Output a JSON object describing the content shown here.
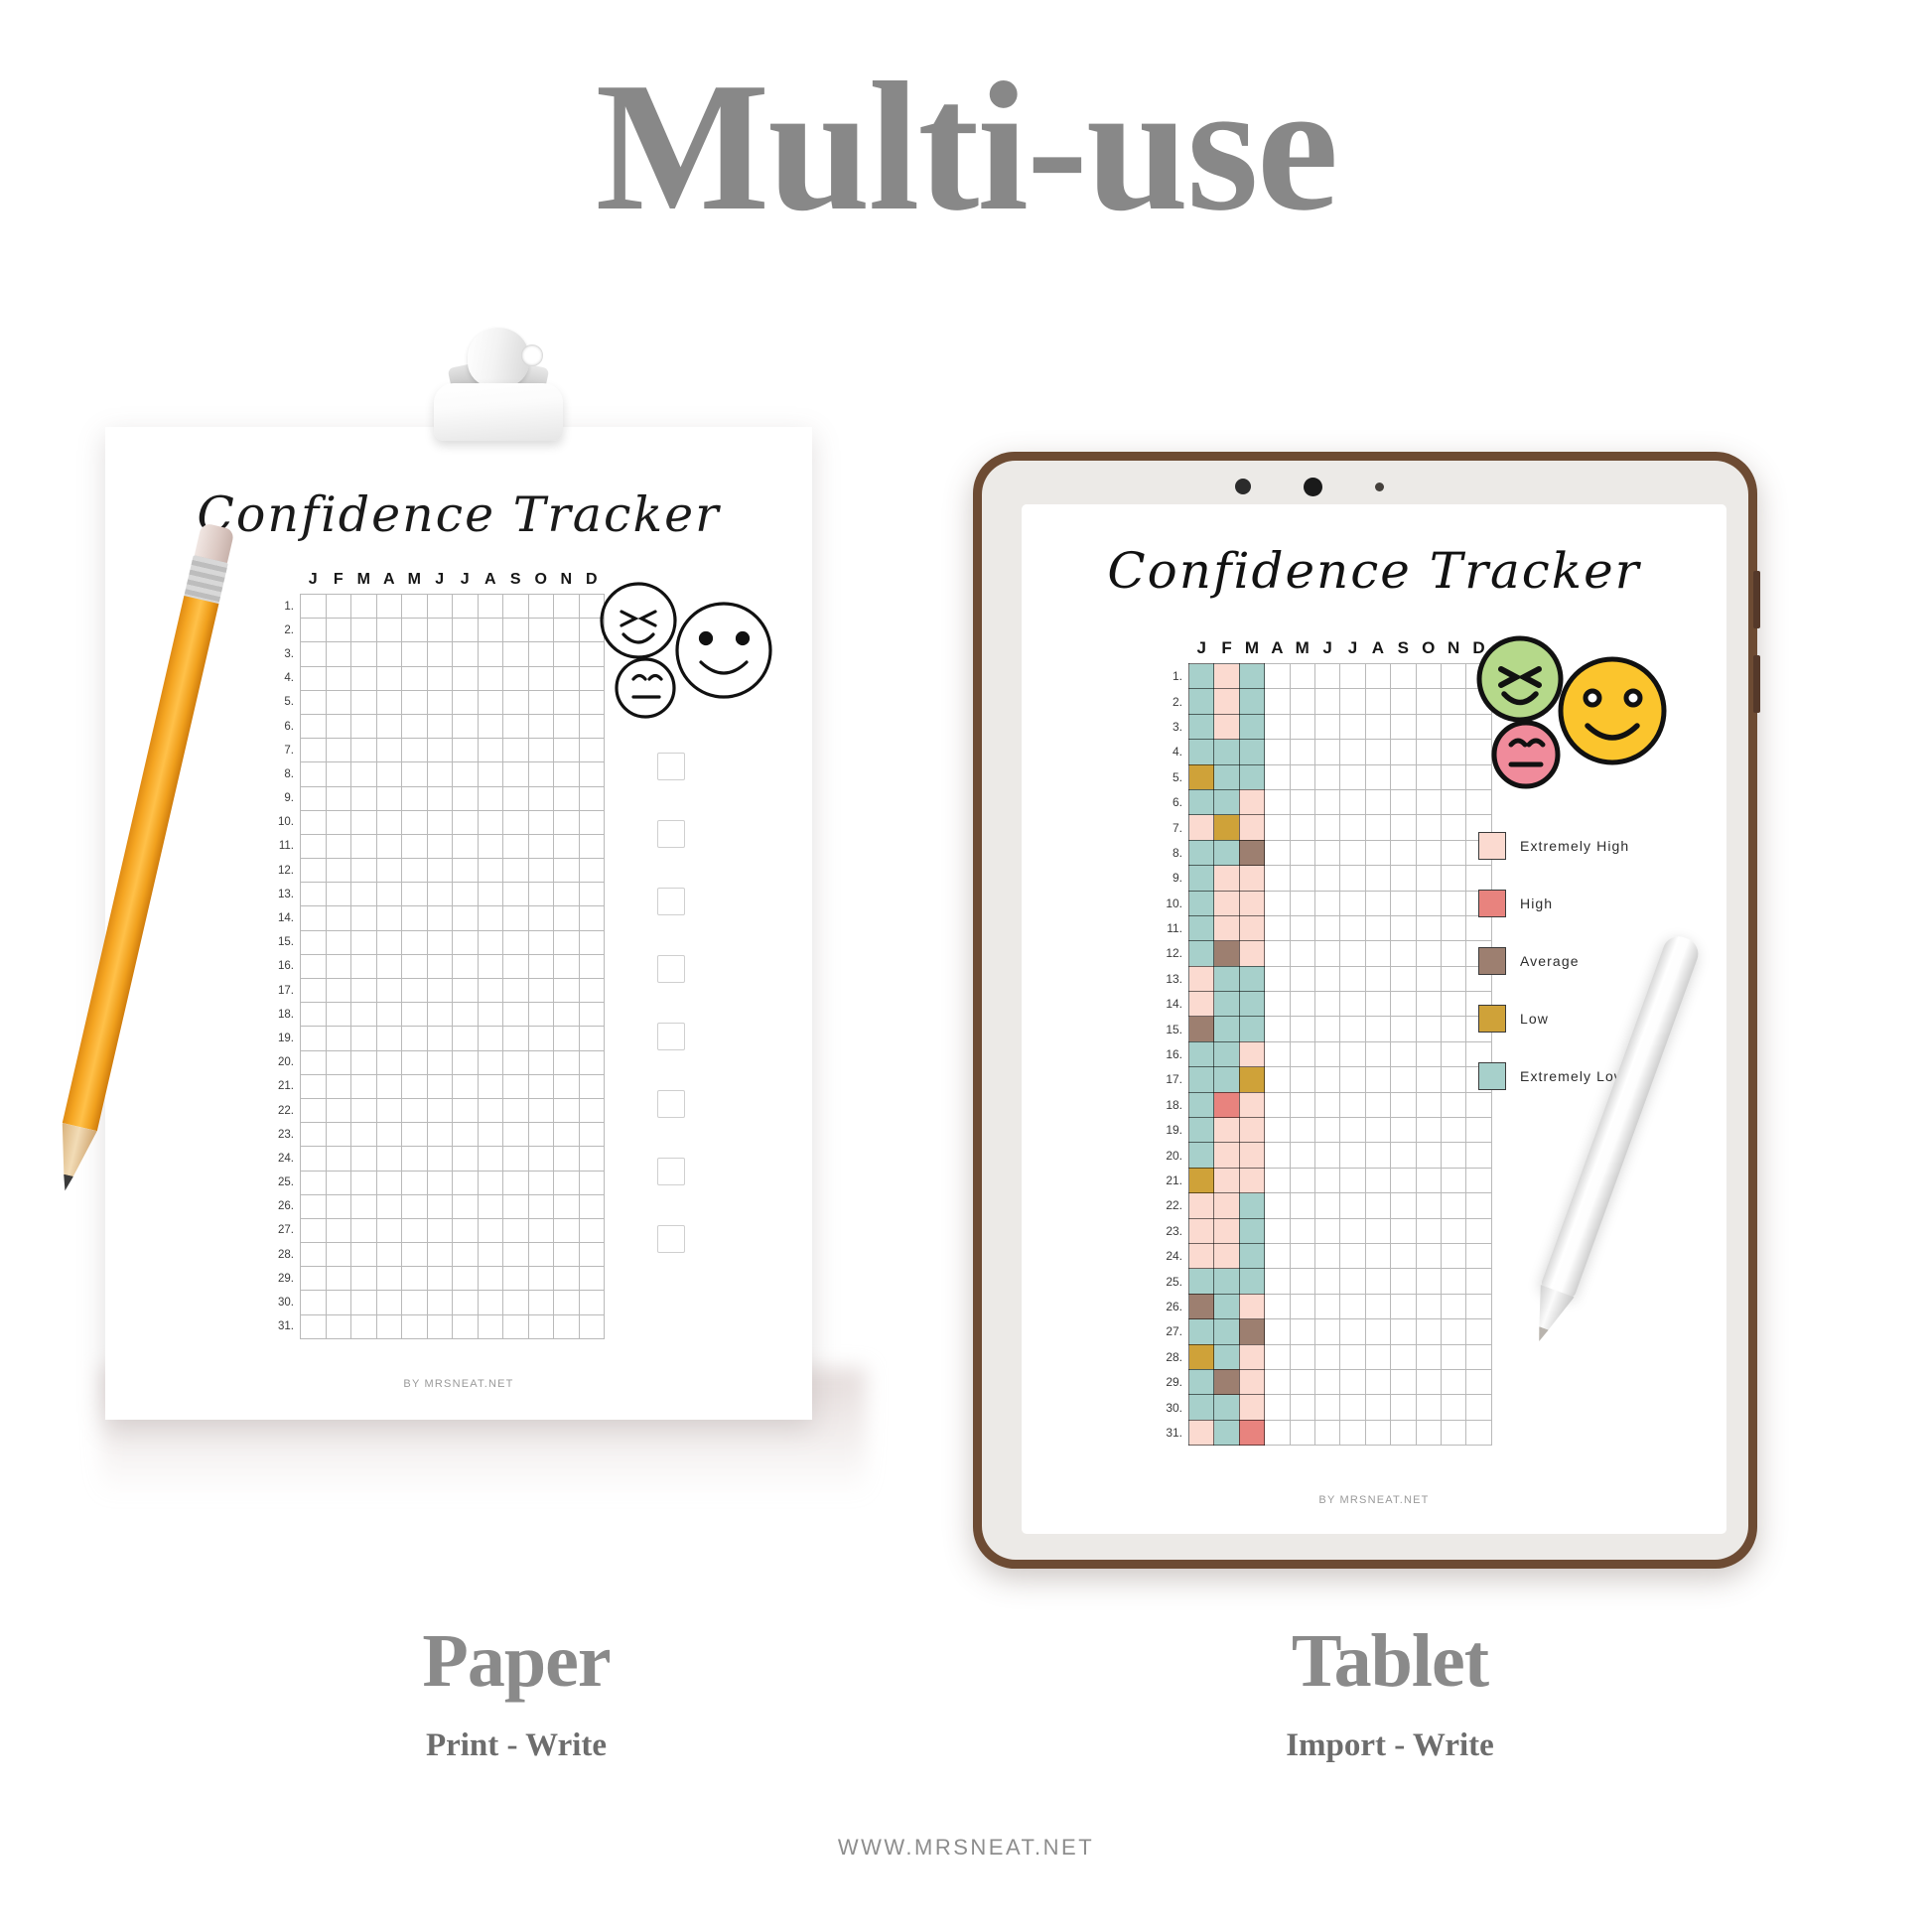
{
  "header": {
    "title": "Multi-use"
  },
  "site_footer": "WWW.MRSNEAT.NET",
  "paper": {
    "sheet_title": "Confidence Tracker",
    "footer": "BY MRSNEAT.NET",
    "caption": "Paper",
    "subcaption": "Print - Write",
    "checkbox_count": 8,
    "faces": [
      "squint-smile-face",
      "big-smile-face",
      "neutral-face"
    ]
  },
  "tablet": {
    "sheet_title": "Confidence Tracker",
    "footer": "BY MRSNEAT.NET",
    "caption": "Tablet",
    "subcaption": "Import - Write",
    "faces": [
      {
        "name": "squint-smile-face",
        "color": "#B5D98A"
      },
      {
        "name": "big-smile-face",
        "color": "#FBC52D"
      },
      {
        "name": "neutral-face",
        "color": "#F08B9B"
      }
    ],
    "legend": [
      {
        "label": "Extremely High",
        "color": "#FBDAD0"
      },
      {
        "label": "High",
        "color": "#E8837E"
      },
      {
        "label": "Average",
        "color": "#9D7F70"
      },
      {
        "label": "Low",
        "color": "#CFA239"
      },
      {
        "label": "Extremely Low",
        "color": "#A7D0CB"
      }
    ]
  },
  "chart_data": {
    "type": "heatmap",
    "title": "Confidence Tracker",
    "xlabel": "",
    "ylabel": "",
    "grid": true,
    "categories": [
      "J",
      "F",
      "M",
      "A",
      "M",
      "J",
      "J",
      "A",
      "S",
      "O",
      "N",
      "D"
    ],
    "rows": [
      "1.",
      "2.",
      "3.",
      "4.",
      "5.",
      "6.",
      "7.",
      "8.",
      "9.",
      "10.",
      "11.",
      "12.",
      "13.",
      "14.",
      "15.",
      "16.",
      "17.",
      "18.",
      "19.",
      "20.",
      "21.",
      "22.",
      "23.",
      "24.",
      "25.",
      "26.",
      "27.",
      "28.",
      "29.",
      "30.",
      "31."
    ],
    "legend_position": "right",
    "value_colors": {
      "extremely_high": "#FBDAD0",
      "high": "#E8837E",
      "average": "#9D7F70",
      "low": "#CFA239",
      "extremely_low": "#A7D0CB",
      "empty": ""
    },
    "values": [
      [
        "extremely_low",
        "extremely_high",
        "extremely_low"
      ],
      [
        "extremely_low",
        "extremely_high",
        "extremely_low"
      ],
      [
        "extremely_low",
        "extremely_high",
        "extremely_low"
      ],
      [
        "extremely_low",
        "extremely_low",
        "extremely_low"
      ],
      [
        "low",
        "extremely_low",
        "extremely_low"
      ],
      [
        "extremely_low",
        "extremely_low",
        "extremely_high"
      ],
      [
        "extremely_high",
        "low",
        "extremely_high"
      ],
      [
        "extremely_low",
        "extremely_low",
        "average"
      ],
      [
        "extremely_low",
        "extremely_high",
        "extremely_high"
      ],
      [
        "extremely_low",
        "extremely_high",
        "extremely_high"
      ],
      [
        "extremely_low",
        "extremely_high",
        "extremely_high"
      ],
      [
        "extremely_low",
        "average",
        "extremely_high"
      ],
      [
        "extremely_high",
        "extremely_low",
        "extremely_low"
      ],
      [
        "extremely_high",
        "extremely_low",
        "extremely_low"
      ],
      [
        "average",
        "extremely_low",
        "extremely_low"
      ],
      [
        "extremely_low",
        "extremely_low",
        "extremely_high"
      ],
      [
        "extremely_low",
        "extremely_low",
        "low"
      ],
      [
        "extremely_low",
        "high",
        "extremely_high"
      ],
      [
        "extremely_low",
        "extremely_high",
        "extremely_high"
      ],
      [
        "extremely_low",
        "extremely_high",
        "extremely_high"
      ],
      [
        "low",
        "extremely_high",
        "extremely_high"
      ],
      [
        "extremely_high",
        "extremely_high",
        "extremely_low"
      ],
      [
        "extremely_high",
        "extremely_high",
        "extremely_low"
      ],
      [
        "extremely_high",
        "extremely_high",
        "extremely_low"
      ],
      [
        "extremely_low",
        "extremely_low",
        "extremely_low"
      ],
      [
        "average",
        "extremely_low",
        "extremely_high"
      ],
      [
        "extremely_low",
        "extremely_low",
        "average"
      ],
      [
        "low",
        "extremely_low",
        "extremely_high"
      ],
      [
        "extremely_low",
        "average",
        "extremely_high"
      ],
      [
        "extremely_low",
        "extremely_low",
        "extremely_high"
      ],
      [
        "extremely_high",
        "extremely_low",
        "high"
      ]
    ]
  }
}
